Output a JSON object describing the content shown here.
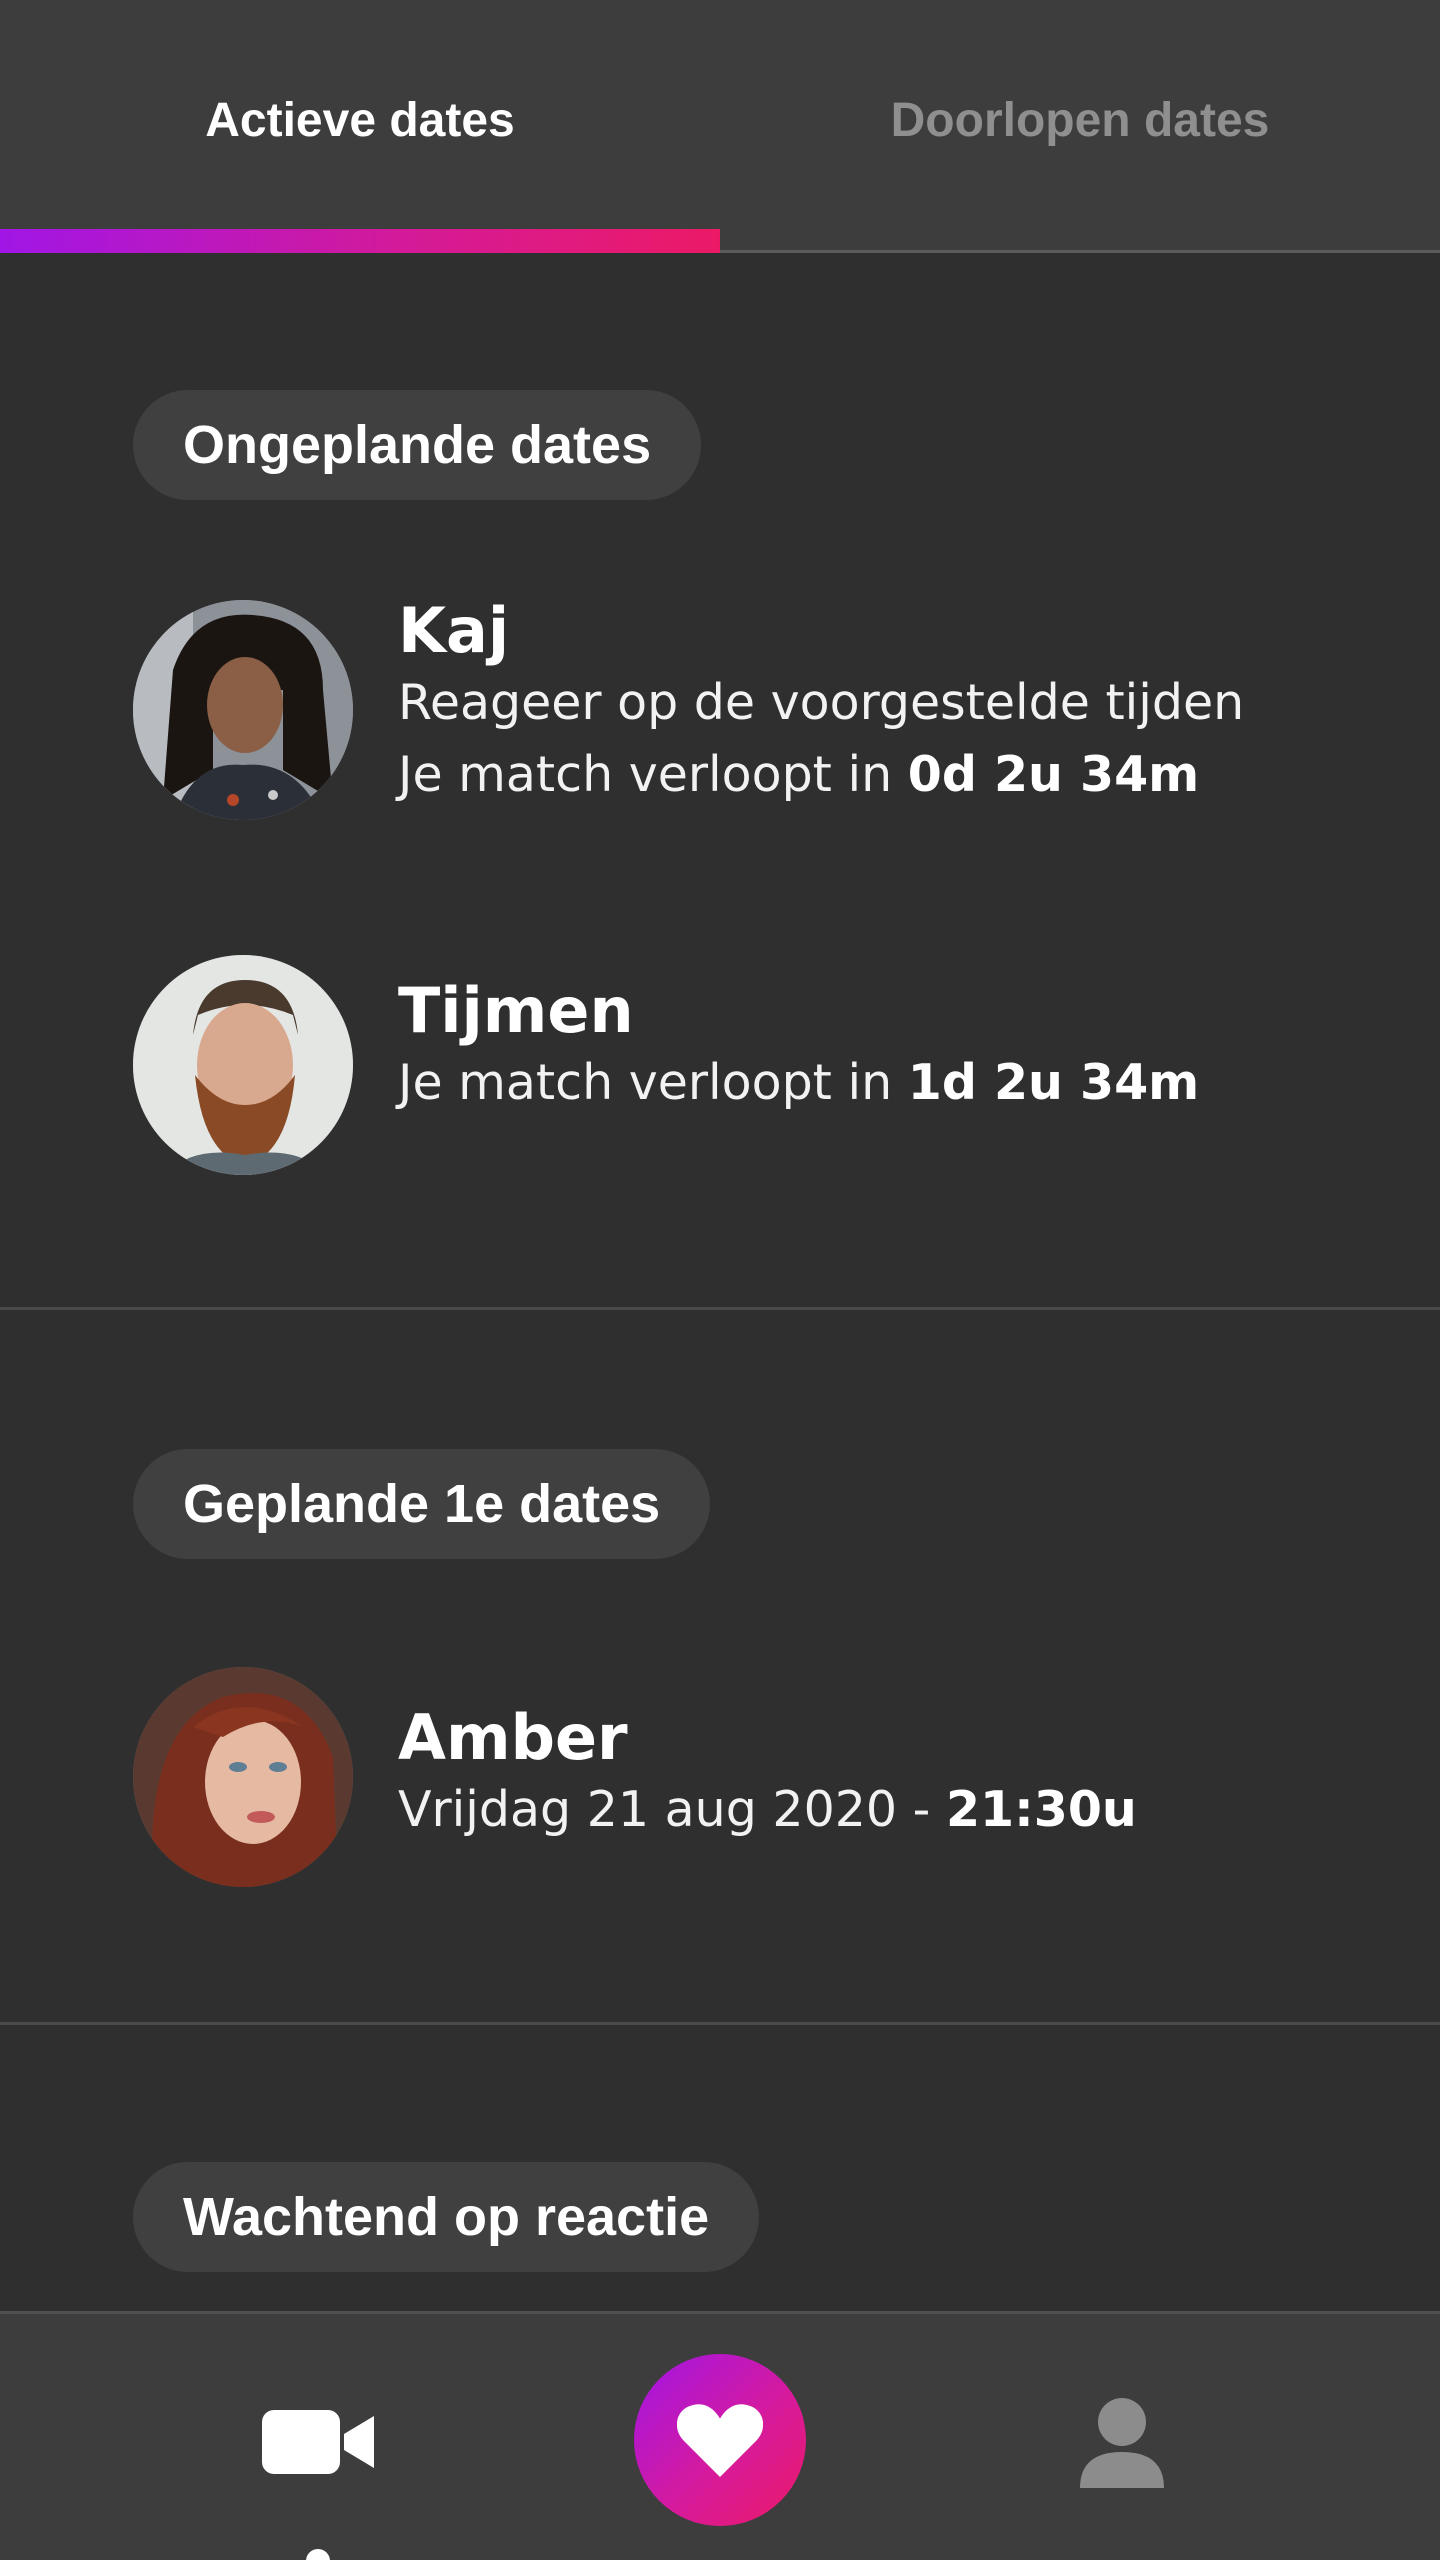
{
  "tabs": {
    "active_label": "Actieve dates",
    "inactive_label": "Doorlopen dates"
  },
  "sections": {
    "unplanned": "Ongeplande dates",
    "planned": "Geplande 1e dates",
    "waiting": "Wachtend op reactie"
  },
  "matches": {
    "kaj": {
      "name": "Kaj",
      "status": "Reageer op de voorgestelde tijden",
      "expiry_prefix": "Je match verloopt in ",
      "expiry_value": "0d 2u 34m"
    },
    "tijmen": {
      "name": "Tijmen",
      "expiry_prefix": "Je match verloopt in ",
      "expiry_value": "1d 2u 34m"
    },
    "amber": {
      "name": "Amber",
      "date_prefix": "Vrijdag 21 aug 2020 - ",
      "time": "21:30u"
    }
  },
  "nav": {
    "items": [
      "camera-icon",
      "heart-icon",
      "profile-icon"
    ],
    "active": "heart-icon"
  },
  "colors": {
    "background": "#2f2f30",
    "bar": "#3d3d3e",
    "pill": "#404041",
    "gradient_start": "#a116e6",
    "gradient_end": "#ec1a66"
  }
}
